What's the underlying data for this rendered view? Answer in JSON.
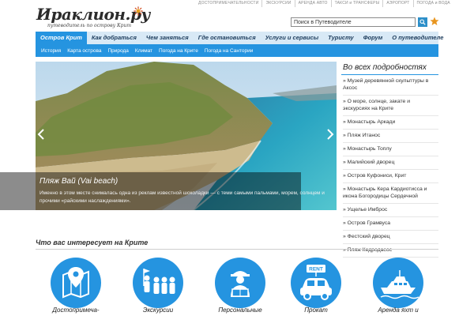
{
  "top_links": [
    "ДОСТОПРИМЕЧАТЕЛЬНОСТИ",
    "ЭКСКУРСИИ",
    "АРЕНДА АВТО",
    "ТАКСИ и ТРАНСФЕРЫ",
    "АЭРОПОРТ",
    "ПОГОДА и ВОДА"
  ],
  "logo": {
    "title": "Ираклион.ру",
    "subtitle": "путеводитель по острову Крит"
  },
  "search": {
    "placeholder": "Поиск в Путеводителе",
    "icon": "search-icon",
    "favorite_icon": "star-icon"
  },
  "main_nav": [
    "Остров Крит",
    "Как добраться",
    "Чем заняться",
    "Где остановиться",
    "Услуги и сервисы",
    "Туристу",
    "Форум",
    "О путеводителе"
  ],
  "sub_nav": [
    "История",
    "Карта острова",
    "Природа",
    "Климат",
    "Погода на Крите",
    "Погода на Сантории"
  ],
  "hero": {
    "title": "Пляж Вай (Vai beach)",
    "text": "Именно в этом месте снималась одна из реклам известной шоколадки — с теми самыми пальмами, морем, солнцем и прочими «райскими наслаждениями».",
    "prev_icon": "chevron-left-icon",
    "next_icon": "chevron-right-icon"
  },
  "sidebar": {
    "title": "Во всех подробностях",
    "items": [
      "» Музей деревянной скульптуры в Аксос",
      "» О море, солнце, закате и экскурсиях на Крите",
      "» Монастырь Аркади",
      "» Пляж Итанос",
      "» Монастырь Топлу",
      "» Малийский дворец",
      "» Остров Куфониси, Крит",
      "» Монастырь Кера Кардиотисса и икона Богородицы Сердечной",
      "» Ущелье Имброс",
      "» Остров Грамвуса",
      "» Фестский дворец",
      "» Пляж Кедродасос"
    ]
  },
  "interests": {
    "title": "Что вас интересует на Крите",
    "items": [
      {
        "line1": "Достопримеча-",
        "line2": "",
        "icon": "map-pin-icon"
      },
      {
        "line1": "Экскурсии",
        "line2": "",
        "icon": "guide-group-icon"
      },
      {
        "line1": "Персональные",
        "line2": "",
        "icon": "personal-guide-icon"
      },
      {
        "line1": "Прокат",
        "line2": "",
        "icon": "rent-car-icon"
      },
      {
        "line1": "Аренда яхт и",
        "line2": "",
        "icon": "yacht-icon"
      }
    ],
    "rent_sign": "RENT"
  },
  "colors": {
    "accent": "#2594e0",
    "nav_bg": "#d8e9f6",
    "nav_text": "#1d3c5c"
  }
}
